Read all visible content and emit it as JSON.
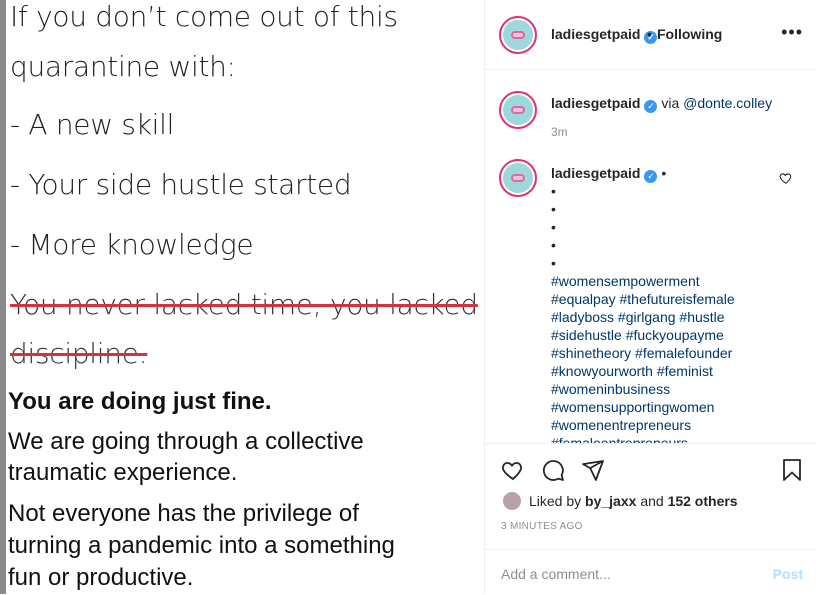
{
  "post_image": {
    "lines": [
      "If you don’t come out of this",
      "quarantine with:",
      "- A new skill",
      "- Your side hustle started",
      "- More knowledge"
    ],
    "struck_lines": [
      "You never lacked time, you lacked",
      "discipline."
    ],
    "bold_line": "You are doing just fine.",
    "body_lines": [
      "We are going through a collective",
      "traumatic experience.",
      "Not everyone has the privilege of",
      "turning a pandemic into a something",
      "fun or productive."
    ]
  },
  "header": {
    "username": "ladiesgetpaid",
    "separator": "•",
    "follow_status": "Following",
    "more_icon": "more-horizontal-icon"
  },
  "caption": {
    "username": "ladiesgetpaid",
    "via_text": "via",
    "via_handle": "@donte.colley",
    "time": "3m"
  },
  "comment": {
    "username": "ladiesgetpaid",
    "trailing": "•",
    "bullets": [
      "•",
      "•",
      "•",
      "•",
      "•"
    ],
    "hashtags": [
      "#womensempowerment",
      "#equalpay #thefutureisfemale",
      "#ladyboss #girlgang #hustle",
      "#sidehustle #fuckyoupayme",
      "#shinetheory #femalefounder",
      "#knowyourworth #feminist",
      "#womeninbusiness",
      "#womensupportingwomen",
      "#womenentrepreneurs",
      "#femaleentrepreneurs"
    ]
  },
  "actions": {
    "like_icon": "heart-icon",
    "comment_icon": "comment-icon",
    "share_icon": "share-icon",
    "save_icon": "bookmark-icon",
    "liked_by_prefix": "Liked by",
    "liked_by_user": "by_jaxx",
    "liked_by_and": "and",
    "liked_by_others": "152 others",
    "timestamp": "3 MINUTES AGO"
  },
  "add_comment": {
    "placeholder": "Add a comment...",
    "post_label": "Post"
  },
  "colors": {
    "link": "#00376b",
    "verified": "#3897f0",
    "strike": "#d6323e",
    "post_disabled": "#b2dffc"
  }
}
